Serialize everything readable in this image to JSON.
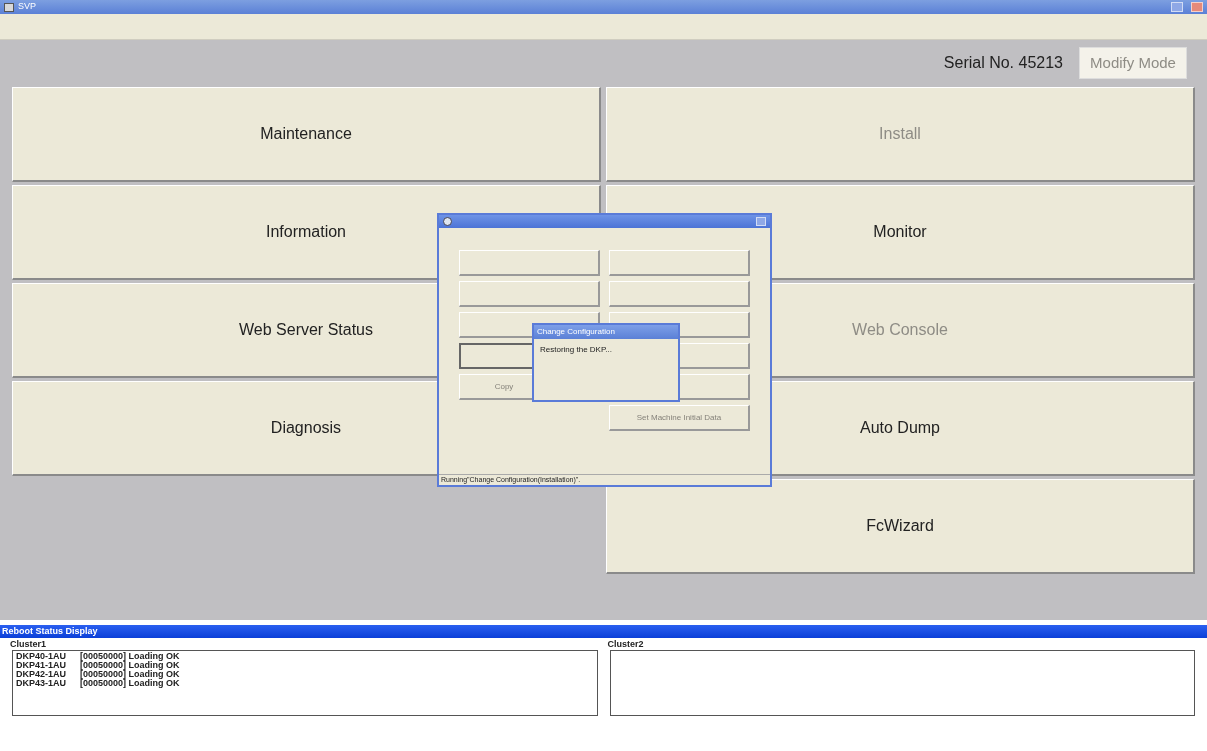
{
  "window": {
    "title": "SVP"
  },
  "header": {
    "serial": "Serial No. 45213",
    "modify_button": {
      "label": "Modify Mode",
      "disabled": true
    }
  },
  "main_buttons": [
    {
      "kind": "button",
      "label": "Maintenance",
      "disabled": false
    },
    {
      "kind": "button",
      "label": "Install",
      "disabled": true
    },
    {
      "kind": "button",
      "label": "Information",
      "disabled": false
    },
    {
      "kind": "button",
      "label": "Monitor",
      "disabled": false
    },
    {
      "kind": "button",
      "label": "Web Server Status",
      "disabled": false
    },
    {
      "kind": "button",
      "label": "Web Console",
      "disabled": true
    },
    {
      "kind": "button",
      "label": "Diagnosis",
      "disabled": false
    },
    {
      "kind": "button",
      "label": "Auto Dump",
      "disabled": false
    },
    {
      "kind": "blank"
    },
    {
      "kind": "button",
      "label": "FcWizard",
      "disabled": false
    }
  ],
  "dialog": {
    "buttons": [
      {
        "focused": false
      },
      {
        "focused": false
      },
      {
        "focused": false
      },
      {
        "focused": false
      },
      {
        "focused": false
      },
      {
        "focused": false
      },
      {
        "focused": true
      },
      {
        "focused": false
      },
      {
        "label": "Copy",
        "disabled": true,
        "focused": false
      },
      {
        "focused": false
      },
      {
        "kind": "blank"
      },
      {
        "label": "Set Machine Initial Data",
        "disabled": true,
        "focused": false
      }
    ],
    "status": "Running\"Change Configuration(Installation)\".",
    "popup": {
      "title": "Change Configuration",
      "message": "Restoring the DKP..."
    }
  },
  "reboot_panel": {
    "title": "Reboot Status Display",
    "clusters": [
      {
        "label": "Cluster1",
        "lines": [
          {
            "name": "DKP40-1AU",
            "status": "[00050000] Loading OK"
          },
          {
            "name": "DKP41-1AU",
            "status": "[00050000] Loading OK"
          },
          {
            "name": "DKP42-1AU",
            "status": "[00050000] Loading OK"
          },
          {
            "name": "DKP43-1AU",
            "status": "[00050000] Loading OK"
          }
        ]
      },
      {
        "label": "Cluster2"
      }
    ]
  }
}
